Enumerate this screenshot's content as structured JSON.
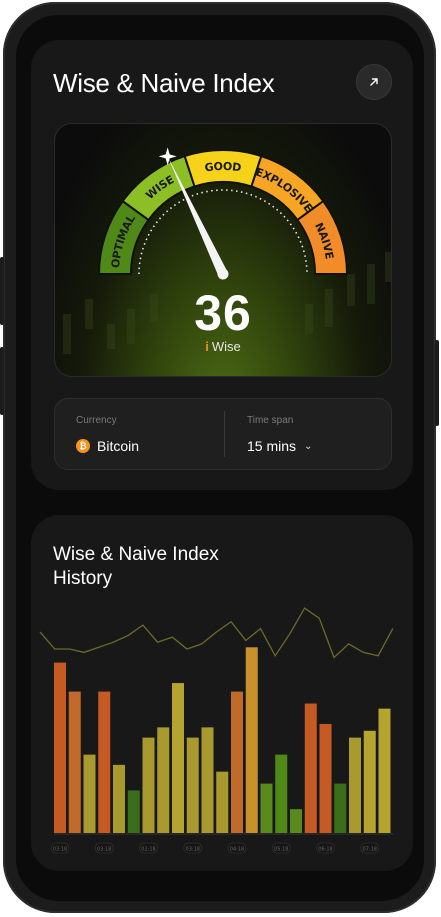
{
  "app": {
    "title": "Wise & Naive Index"
  },
  "gauge": {
    "segments": [
      {
        "label": "OPTIMAL",
        "color": "#4f8a18"
      },
      {
        "label": "WISE",
        "color": "#8cbf26"
      },
      {
        "label": "GOOD",
        "color": "#f6d21a"
      },
      {
        "label": "EXPLOSIVE",
        "color": "#f6a623"
      },
      {
        "label": "NAIVE",
        "color": "#f28c28"
      }
    ],
    "value": "36",
    "status_label": "Wise",
    "status_icon": "info-mark"
  },
  "controls": {
    "currency_caption": "Currency",
    "currency_value": "Bitcoin",
    "currency_icon": "bitcoin-icon",
    "timespan_caption": "Time span",
    "timespan_value": "15 mins"
  },
  "history": {
    "title_line1": "Wise & Naive Index",
    "title_line2": "History"
  },
  "chart_data": {
    "type": "bar",
    "title": "Wise & Naive Index History",
    "categories": [
      "03:18",
      "",
      "",
      "03:18",
      "",
      "",
      "02:18",
      "",
      "",
      "03:18",
      "",
      "",
      "04:18",
      "",
      "",
      "05:18",
      "",
      "",
      "06:18",
      "",
      "",
      "07:18",
      "",
      ""
    ],
    "bars": [
      {
        "value": 100,
        "color": "#c55a24"
      },
      {
        "value": 83,
        "color": "#c06a2b"
      },
      {
        "value": 46,
        "color": "#a89a2e"
      },
      {
        "value": 83,
        "color": "#c55a24"
      },
      {
        "value": 40,
        "color": "#a89a2e"
      },
      {
        "value": 25,
        "color": "#3a6e1a"
      },
      {
        "value": 56,
        "color": "#a89a2e"
      },
      {
        "value": 62,
        "color": "#a89a2e"
      },
      {
        "value": 88,
        "color": "#b5a430"
      },
      {
        "value": 56,
        "color": "#a89a2e"
      },
      {
        "value": 62,
        "color": "#a89a2e"
      },
      {
        "value": 36,
        "color": "#a89a2e"
      },
      {
        "value": 83,
        "color": "#c06a2b"
      },
      {
        "value": 109,
        "color": "#c9912b"
      },
      {
        "value": 29,
        "color": "#5a8a1e"
      },
      {
        "value": 46,
        "color": "#4f8a18"
      },
      {
        "value": 14,
        "color": "#5a8a1e"
      },
      {
        "value": 76,
        "color": "#c55a24"
      },
      {
        "value": 64,
        "color": "#c55a24"
      },
      {
        "value": 29,
        "color": "#3a6e1a"
      },
      {
        "value": 56,
        "color": "#a89a2e"
      },
      {
        "value": 60,
        "color": "#b5a430"
      },
      {
        "value": 73,
        "color": "#b5a430"
      }
    ],
    "line": [
      118,
      108,
      108,
      106,
      109,
      112,
      116,
      122,
      112,
      115,
      108,
      111,
      118,
      124,
      113,
      120,
      104,
      117,
      132,
      126,
      103,
      111,
      106,
      104,
      120
    ],
    "ylim": [
      0,
      135
    ]
  }
}
